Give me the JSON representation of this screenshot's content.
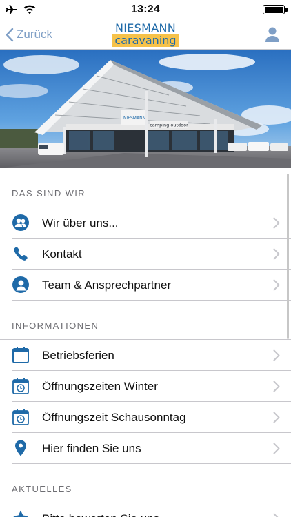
{
  "status_bar": {
    "time": "13:24"
  },
  "nav": {
    "back_label": "Zurück",
    "logo_top": "NIESMANN",
    "logo_bottom": "caravaning"
  },
  "hero": {
    "sign_text": "NIESMANN",
    "banner_text": "camping  outdoor"
  },
  "sections": [
    {
      "title": "DAS SIND WIR",
      "items": [
        {
          "label": "Wir über uns...",
          "icon": "people-icon"
        },
        {
          "label": "Kontakt",
          "icon": "phone-icon"
        },
        {
          "label": "Team & Ansprechpartner",
          "icon": "headset-person-icon"
        }
      ]
    },
    {
      "title": "INFORMATIONEN",
      "items": [
        {
          "label": "Betriebsferien",
          "icon": "calendar-icon"
        },
        {
          "label": "Öffnungszeiten Winter",
          "icon": "calendar-clock-icon"
        },
        {
          "label": "Öffnungszeit Schausonntag",
          "icon": "calendar-clock-icon"
        },
        {
          "label": "Hier finden Sie uns",
          "icon": "location-pin-icon"
        }
      ]
    },
    {
      "title": "AKTUELLES",
      "items": [
        {
          "label": "Bitte bewerten Sie uns",
          "icon": "star-icon"
        }
      ]
    }
  ],
  "colors": {
    "accent": "#1f6aa8",
    "back": "#7f9fc6",
    "logo_yellow": "#f6c24a"
  }
}
